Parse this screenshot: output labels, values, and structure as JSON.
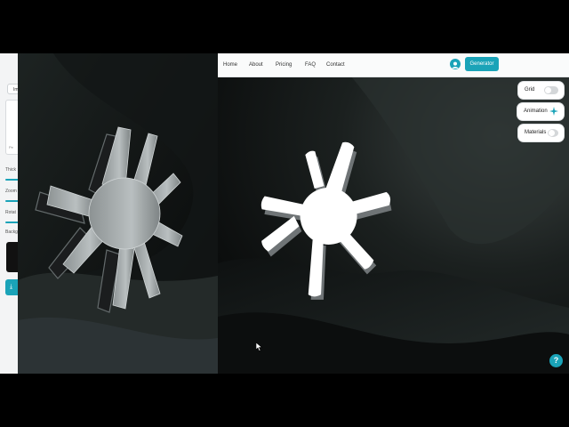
{
  "editor": {
    "tab_label": "Im",
    "box_caption": "Pe",
    "labels": [
      "Thick",
      "Zoom",
      "Rotat",
      "Backg"
    ],
    "download_icon": "download-icon"
  },
  "nav": {
    "links": [
      "Home",
      "About",
      "Pricing",
      "FAQ",
      "Contact"
    ],
    "avatar_icon": "user-icon",
    "generator_label": "Generator"
  },
  "controls": {
    "grid_label": "Grid",
    "animation_label": "Animation",
    "materials_label": "Materials",
    "grid_on": false,
    "materials_on": false
  },
  "help_icon": "help-icon",
  "colors": {
    "accent": "#1aa3b8",
    "logo_dark": "#a7adae",
    "logo_light": "#ffffff"
  }
}
